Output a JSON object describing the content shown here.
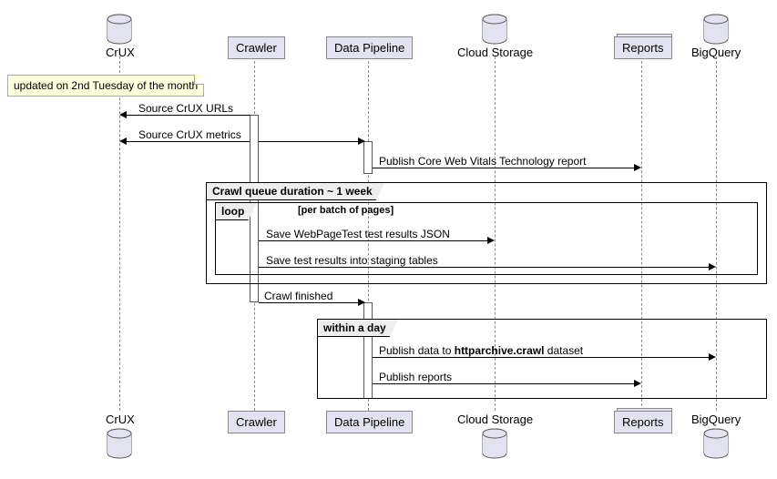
{
  "participants": {
    "crux": "CrUX",
    "crawler": "Crawler",
    "pipeline": "Data Pipeline",
    "storage": "Cloud Storage",
    "reports": "Reports",
    "bigquery": "BigQuery"
  },
  "note": "updated on 2nd Tuesday of the month",
  "messages": {
    "m1": "Source CrUX URLs",
    "m2": "Source CrUX metrics",
    "m3": "Publish Core Web Vitals Technology report",
    "m4": "Save WebPageTest test results JSON",
    "m5": "Save test results into staging tables",
    "m6": "Crawl finished",
    "m7a": "Publish data to ",
    "m7b": "httparchive.crawl",
    "m7c": " dataset",
    "m8": "Publish reports"
  },
  "frames": {
    "f1_title": "Crawl queue duration ~ 1 week",
    "f2_title": "loop",
    "f2_sub": "[per batch of pages]",
    "f3_title": "within a day"
  }
}
